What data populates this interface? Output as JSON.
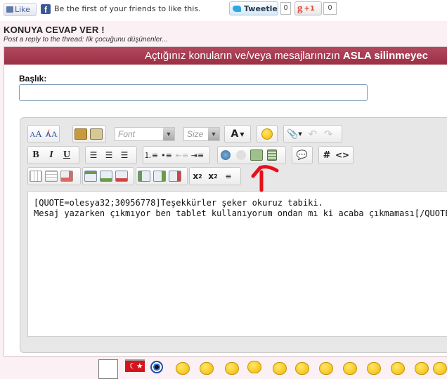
{
  "social": {
    "like_label": "Like",
    "fb_text": "Be the first of your friends to like this.",
    "tweet_label": "Tweetle",
    "tweet_count": "0",
    "gplus_label": "+1",
    "gplus_count": "0"
  },
  "page": {
    "title": "KONUYA CEVAP VER !",
    "subtitle": "Post a reply to the thread: Ilk çocuğunu düşünenler..."
  },
  "banner": {
    "text_before": "Açtığınız konuların ve/veya mesajlarınızın ",
    "text_bold": "ASLA silinmeyec"
  },
  "form": {
    "title_label": "Başlık:",
    "title_value": ""
  },
  "toolbar": {
    "font_placeholder": "Font",
    "size_placeholder": "Size",
    "font_color_label": "A",
    "bold": "B",
    "italic": "I",
    "underline": "U",
    "hash": "#",
    "code": "<>"
  },
  "message": {
    "line1": "[QUOTE=olesya32;30956778]Teşekkürler şeker okuruz tabiki.",
    "line2": "Mesaj yazarken çıkmıyor ben tablet kullanıyorum ondan mı ki acaba çıkmaması[/QUOTE]"
  },
  "colors": {
    "banner": "#a83a50",
    "page_bg": "#fbf0f4",
    "annotation_arrow": "#e5101a"
  }
}
